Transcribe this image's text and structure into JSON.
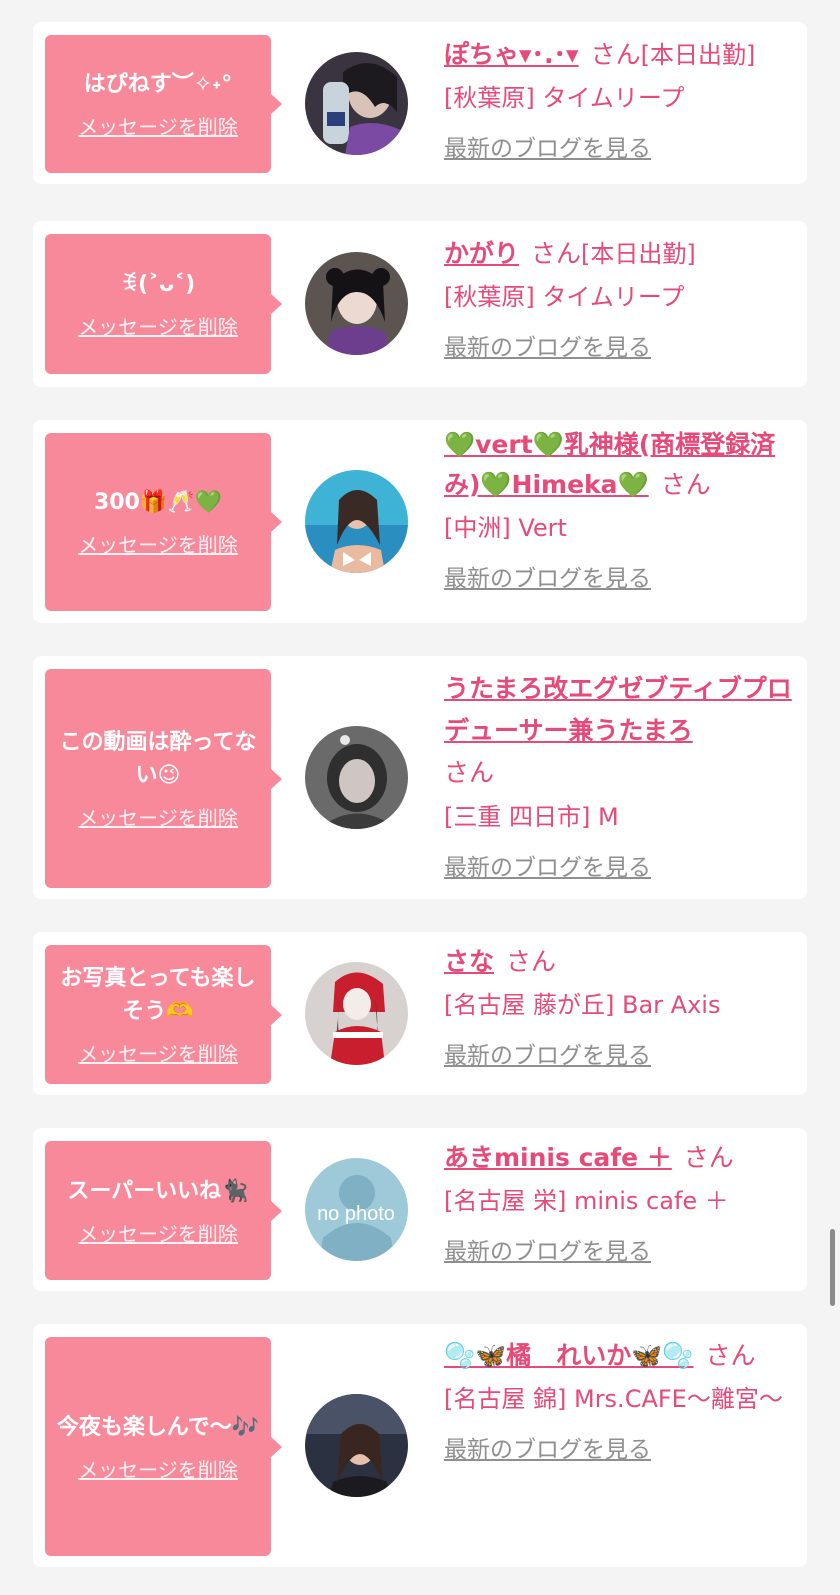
{
  "delete_label": "メッセージを削除",
  "san_label": "さん",
  "blog_label": "最新のブログを見る",
  "colors": {
    "bubble": "#f7899a",
    "name": "#e64a78",
    "link_gray": "#8f8f8f",
    "bg": "#f4f4f4"
  },
  "cards": [
    {
      "message": "はぴねす︶✧˖°",
      "name": "ぽちゃ▾･.･▾",
      "working": "[本日出勤]",
      "shop": "[秋葉原] タイムリープ"
    },
    {
      "message": "ꉂ(˃ᴗ˂)",
      "name": "かがり",
      "working": "[本日出勤]",
      "shop": "[秋葉原] タイムリープ"
    },
    {
      "message": "300🎁🥂💚",
      "name": "💚vert💚乳神様(商標登録済み)💚Himeka💚",
      "working": "",
      "shop": "[中洲] Vert"
    },
    {
      "message": "この動画は酔ってない😉",
      "name": "うたまろ改エグゼブティブプロデューサー兼うたまろ",
      "working": "",
      "shop": "[三重 四日市] M"
    },
    {
      "message": "お写真とっても楽しそう🫶",
      "name": "さな",
      "working": "",
      "shop": "[名古屋 藤が丘] Bar Axis"
    },
    {
      "message": "スーパーいいね🐈‍⬛",
      "name": "あきminis cafe ＋",
      "working": "",
      "shop": "[名古屋 栄] minis cafe ＋",
      "no_photo": "no photo"
    },
    {
      "message": "今夜も楽しんで〜🎶",
      "name": "🫧🦋橘　れいか🦋🫧",
      "working": "",
      "shop": "[名古屋 錦] Mrs.CAFE〜離宮〜"
    }
  ]
}
